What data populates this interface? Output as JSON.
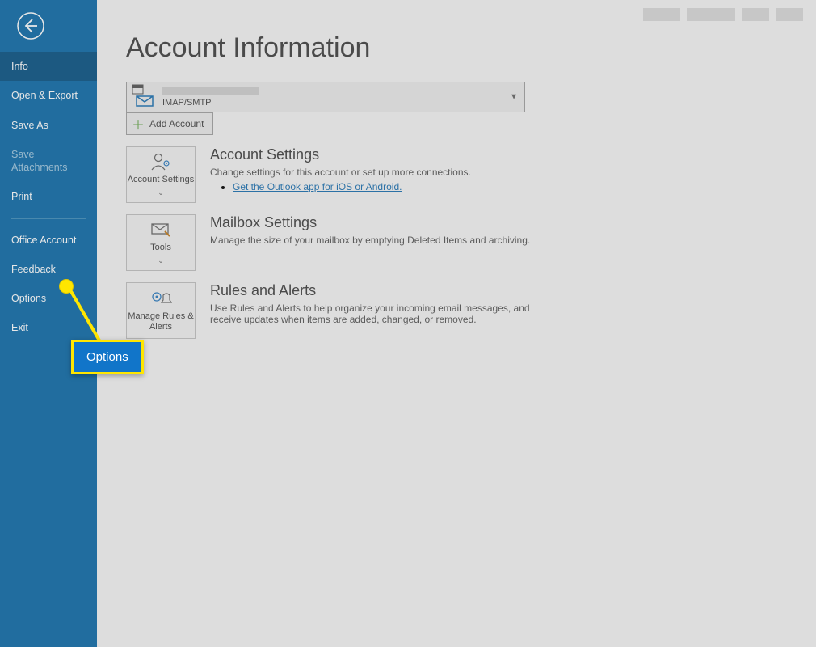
{
  "sidebar": {
    "items": [
      {
        "label": "Info"
      },
      {
        "label": "Open & Export"
      },
      {
        "label": "Save As"
      },
      {
        "label": "Save Attachments"
      },
      {
        "label": "Print"
      },
      {
        "label": "Office Account"
      },
      {
        "label": "Feedback"
      },
      {
        "label": "Options"
      },
      {
        "label": "Exit"
      }
    ]
  },
  "header": {
    "title": "Account Information"
  },
  "account": {
    "type": "IMAP/SMTP",
    "add_label": "Add Account"
  },
  "sections": {
    "account_settings": {
      "button": "Account Settings",
      "title": "Account Settings",
      "desc": "Change settings for this account or set up more connections.",
      "link": "Get the Outlook app for iOS or Android."
    },
    "mailbox": {
      "button": "Tools",
      "title": "Mailbox Settings",
      "desc": "Manage the size of your mailbox by emptying Deleted Items and archiving."
    },
    "rules": {
      "button": "Manage Rules & Alerts",
      "title": "Rules and Alerts",
      "desc": "Use Rules and Alerts to help organize your incoming email messages, and receive updates when items are added, changed, or removed."
    }
  },
  "callout": {
    "label": "Options"
  }
}
